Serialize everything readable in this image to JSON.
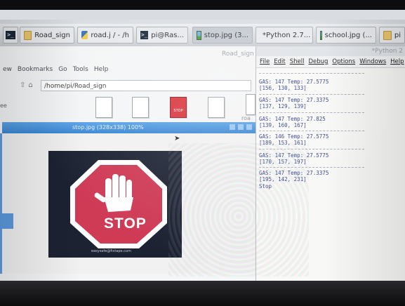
{
  "taskbar": {
    "items": [
      {
        "label": "Road_sign"
      },
      {
        "label": "road.j / - /h"
      },
      {
        "label": "pi@Ras..."
      },
      {
        "label": "stop.jpg (3..."
      },
      {
        "label": "*Python 2.7..."
      },
      {
        "label": "school.jpg (..."
      },
      {
        "label": "pi"
      }
    ],
    "sub_title_left": "Road_sign",
    "sub_title_right": "*Python 2"
  },
  "file_manager": {
    "menu": [
      "ew",
      "Bookmarks",
      "Go",
      "Tools",
      "Help"
    ],
    "path": "/home/pi/Road_sign",
    "tree_label": "ee",
    "side_label": "roa",
    "stop_file_label": "STOP"
  },
  "viewer": {
    "title": "stop.jpg (328x338) 100%",
    "sign_text": "STOP",
    "credit": "easysafe@fixtape.com"
  },
  "shell": {
    "menu": [
      "File",
      "Edit",
      "Shell",
      "Debug",
      "Options",
      "Windows",
      "Help"
    ],
    "output": [
      {
        "line1": "GAS: 147 Temp: 27.5775",
        "line2": "[156, 130, 133]"
      },
      {
        "line1": "GAS: 147 Temp: 27.3375",
        "line2": "[137, 129, 139]"
      },
      {
        "line1": "GAS: 147 Temp: 27.825",
        "line2": "[139, 160, 167]"
      },
      {
        "line1": "GAS: 146 Temp: 27.5775",
        "line2": "[189, 153, 161]"
      },
      {
        "line1": "GAS: 147 Temp: 27.5775",
        "line2": "[170, 157, 197]"
      },
      {
        "line1": "GAS: 147 Temp: 27.3375",
        "line2": "[195, 142, 231]"
      }
    ],
    "last_line": "Stop"
  }
}
